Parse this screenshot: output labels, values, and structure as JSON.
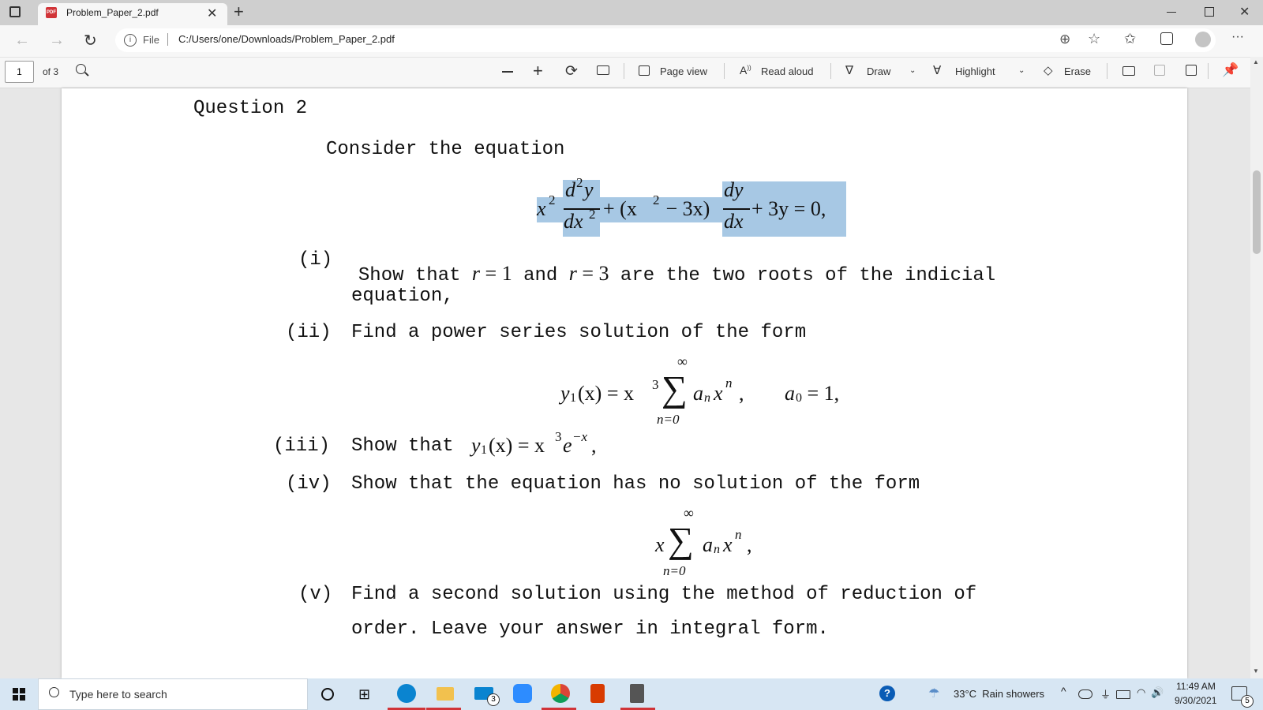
{
  "browser": {
    "tab_title": "Problem_Paper_2.pdf",
    "tab_badge": "PDF",
    "address_prefix": "File",
    "address_url": "C:/Users/one/Downloads/Problem_Paper_2.pdf"
  },
  "pdf_toolbar": {
    "page_number": "1",
    "page_total": "of 3",
    "page_view": "Page view",
    "read_aloud": "Read aloud",
    "draw": "Draw",
    "highlight": "Highlight",
    "erase": "Erase"
  },
  "document": {
    "question_title": "Question 2",
    "intro": "Consider the equation",
    "equation_parts": [
      "x",
      "2",
      "d",
      "2",
      "y",
      "dx",
      "2",
      "+ (x",
      "2",
      " − 3x)",
      "dy",
      "dx",
      "+ 3y = 0,"
    ],
    "items": [
      {
        "num": "(i)",
        "text_a": "Show that ",
        "math_a": "r",
        "eq_a": " = 1",
        "text_b": " and ",
        "math_b": "r",
        "eq_b": " = 3",
        "text_c": " are the two roots of the indicial",
        "text_d": "equation,"
      },
      {
        "num": "(ii)",
        "text": "Find a power series solution of the form"
      },
      {
        "num": "(iii)",
        "text": "Show that "
      },
      {
        "num": "(iv)",
        "text": "Show that the equation has no solution of the form"
      },
      {
        "num": "(v)",
        "text_a": "Find a second solution using the method of reduction of",
        "text_b": "order. Leave your answer in integral form."
      }
    ],
    "series1": {
      "lhs": "y",
      "sub1": "1",
      "arg": "(x) = x",
      "exp3": "3",
      "sum_top": "∞",
      "sum_sym": "∑",
      "sum_bottom": "n=0",
      "term": "a",
      "sub_n": "n",
      "var": "x",
      "exp_n": "n",
      "comma": ",",
      "cond": "a",
      "cond_sub": "0",
      "cond_eq": " = 1,"
    },
    "iii_math": {
      "y": "y",
      "sub1": "1",
      "rest": "(x) = x",
      "exp3": "3",
      "e": "e",
      "expmx": "−x",
      "comma": ","
    },
    "series2": {
      "pre": "x",
      "sum_top": "∞",
      "sum_sym": "∑",
      "sum_bottom": "n=0",
      "term": "a",
      "sub_n": "n",
      "var": "x",
      "exp_n": "n",
      "comma": ","
    }
  },
  "taskbar": {
    "search_placeholder": "Type here to search",
    "weather": "33°C  Rain showers",
    "time": "11:49 AM",
    "date": "9/30/2021",
    "mail_badge": "3",
    "notif_badge": "5"
  },
  "colors": {
    "highlight": "#a7c8e4",
    "taskbar": "#d7e6f3",
    "edge_blue": "#0078d4"
  }
}
